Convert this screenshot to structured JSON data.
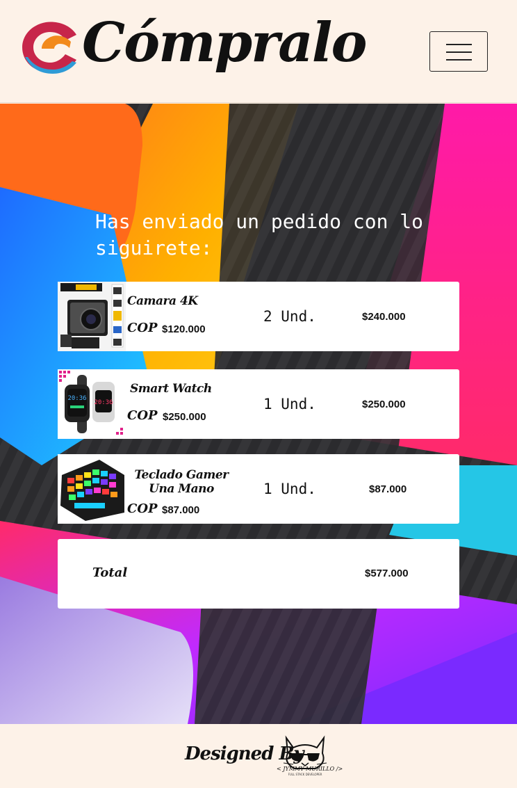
{
  "header": {
    "brand_name": "Cómpralo",
    "menu_button_icon": "hamburger-menu-icon"
  },
  "main": {
    "message": "Has enviado un pedido con lo siguirete:",
    "currency_label": "COP",
    "items": [
      {
        "name": "Camara 4K",
        "unit_price": "$120.000",
        "quantity": "2 Und.",
        "subtotal": "$240.000",
        "thumbnail": "action-camera-image"
      },
      {
        "name": "Smart Watch",
        "unit_price": "$250.000",
        "quantity": "1 Und.",
        "subtotal": "$250.000",
        "thumbnail": "smart-watch-image"
      },
      {
        "name": "Teclado Gamer Una Mano",
        "unit_price": "$87.000",
        "quantity": "1 Und.",
        "subtotal": "$87.000",
        "thumbnail": "gaming-keypad-image"
      }
    ],
    "total": {
      "label": "Total",
      "value": "$577.000"
    }
  },
  "footer": {
    "designed_by": "Designed By",
    "dev_name": "< JYMMY MURILLO />",
    "dev_role": "FULL STACK DEVELOPER"
  },
  "colors": {
    "page_bg": "#fdf2e8",
    "card_bg": "#ffffff",
    "text": "#111111",
    "brand_red": "#c7264a",
    "brand_orange": "#f28a1c",
    "brand_blue": "#2f9bd6"
  }
}
